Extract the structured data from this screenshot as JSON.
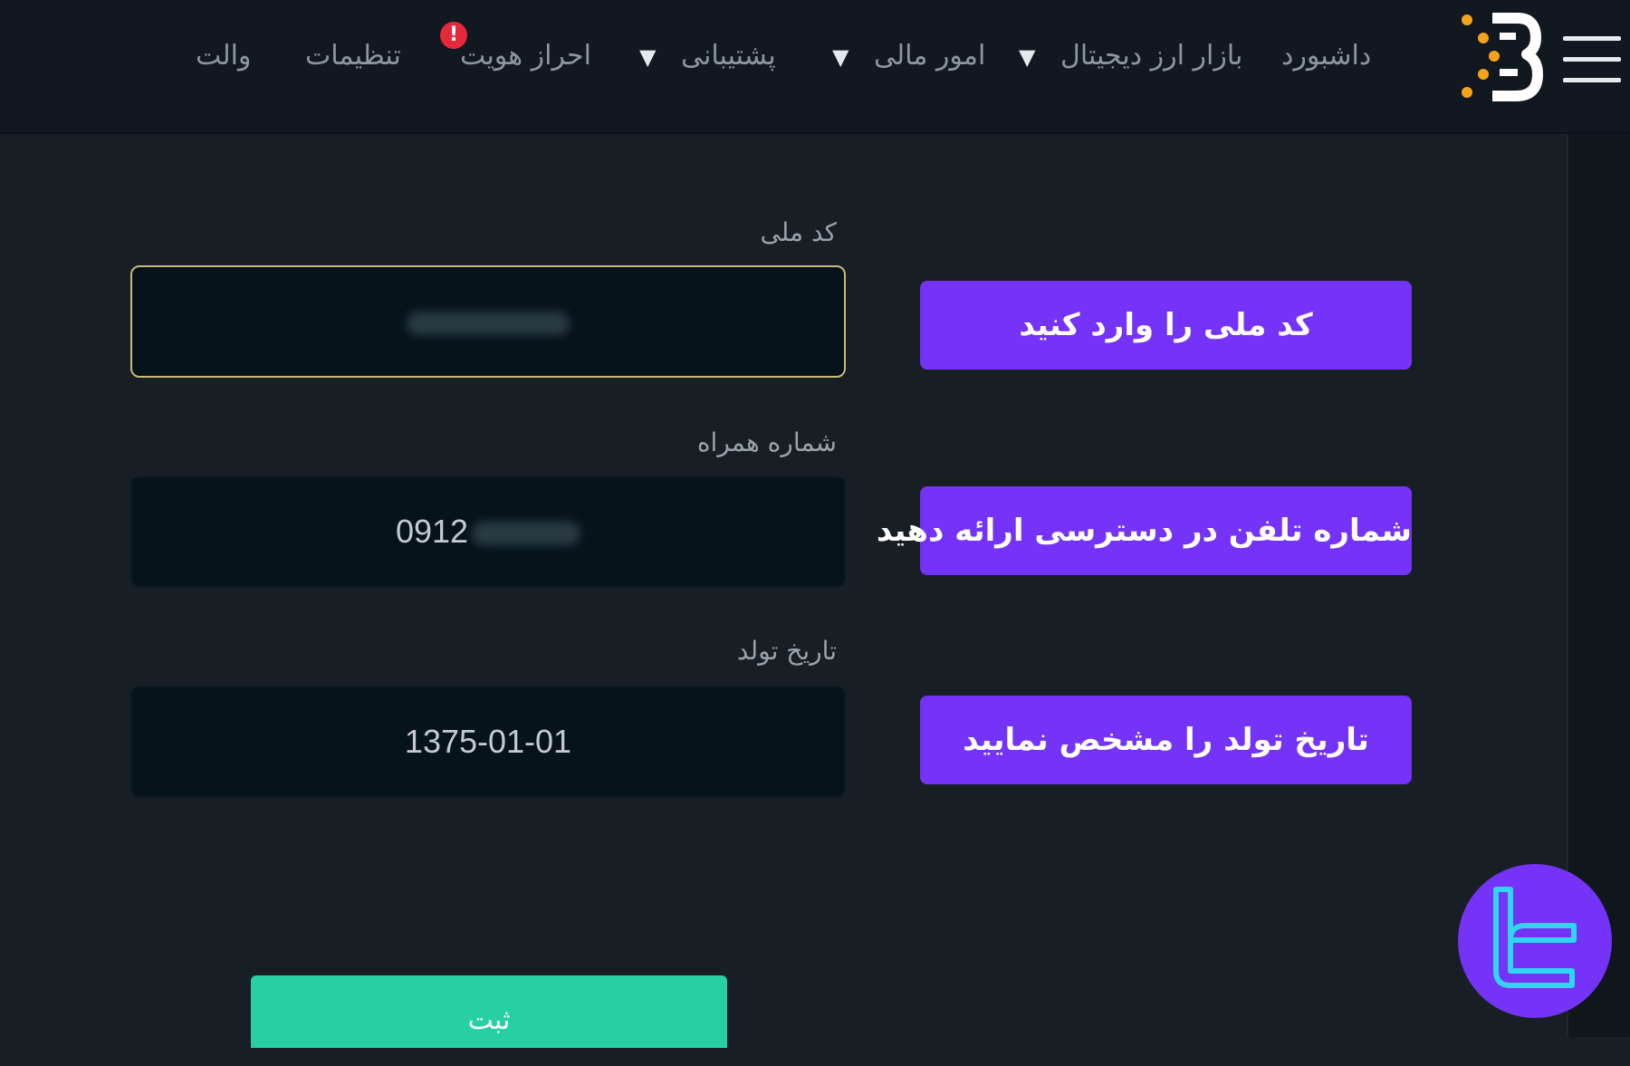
{
  "colors": {
    "page_background": "#171f25",
    "nav_background": "#111820",
    "accent_purple": "#7433f7",
    "submit_green": "#27d0a2",
    "alert_red": "#e5283a",
    "focus_border": "#cbb87a",
    "logo_orange": "#f5a31a"
  },
  "nav": {
    "menu_icon": "hamburger-menu-icon",
    "logo_icon": "b-logo-icon",
    "items": [
      {
        "label": "داشبورد",
        "has_dropdown": false
      },
      {
        "label": "بازار ارز دیجیتال",
        "has_dropdown": true
      },
      {
        "label": "امور مالی",
        "has_dropdown": true
      },
      {
        "label": "پشتیبانی",
        "has_dropdown": true
      },
      {
        "label": "احراز هویت",
        "has_dropdown": false,
        "alert": "!"
      },
      {
        "label": "تنظیمات",
        "has_dropdown": false
      },
      {
        "label": "والت",
        "has_dropdown": false
      }
    ],
    "dropdown_caret": "▼"
  },
  "form": {
    "national_code": {
      "label": "کد ملی",
      "value": ""
    },
    "mobile": {
      "label": "شماره همراه",
      "value_prefix": "0912"
    },
    "birth_date": {
      "label": "تاریخ تولد",
      "value": "1375-01-01"
    },
    "submit_label": "ثبت"
  },
  "hints": {
    "national_code": "کد ملی را وارد کنید",
    "mobile": "شماره تلفن در دسترسی ارائه دهید",
    "birth_date": "تاریخ تولد را مشخص نمایید"
  },
  "watermark_icon": "tc-logo-icon"
}
